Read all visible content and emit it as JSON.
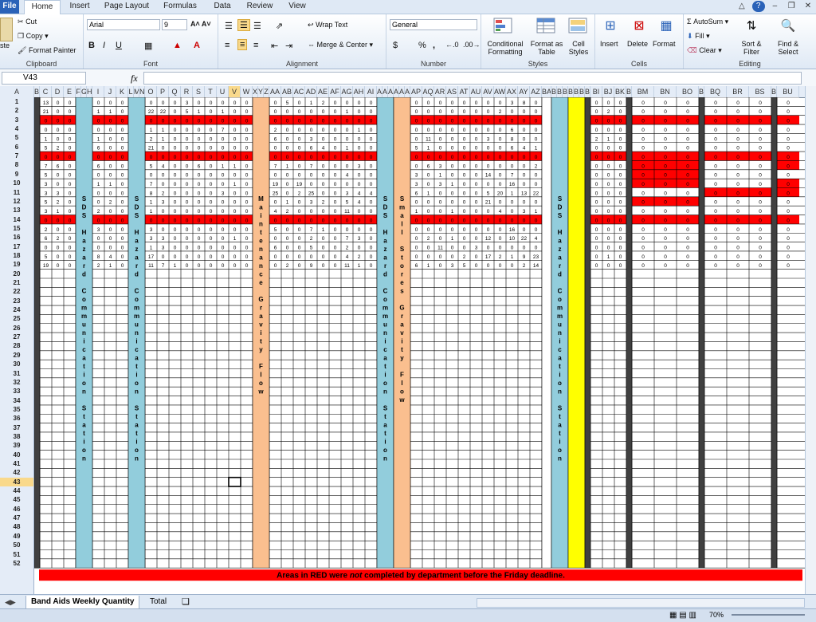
{
  "ribbon_tabs": [
    "File",
    "Home",
    "Insert",
    "Page Layout",
    "Formulas",
    "Data",
    "Review",
    "View"
  ],
  "clipboard": {
    "cut": "Cut",
    "copy": "Copy",
    "format_painter": "Format Painter",
    "paste_partial": "ste",
    "label": "Clipboard"
  },
  "font": {
    "name": "Arial",
    "size": "9",
    "label": "Font"
  },
  "alignment": {
    "wrap_text": "Wrap Text",
    "merge_center": "Merge & Center",
    "label": "Alignment"
  },
  "number": {
    "format": "General",
    "currency": "$",
    "percent": "%",
    "comma": ",",
    "label": "Number"
  },
  "styles": {
    "conditional": "Conditional Formatting",
    "format_table": "Format as Table",
    "cell_styles": "Cell Styles",
    "label": "Styles"
  },
  "cells_group": {
    "insert": "Insert",
    "delete": "Delete",
    "format": "Format",
    "label": "Cells"
  },
  "editing": {
    "autosum": "AutoSum",
    "fill": "Fill",
    "clear": "Clear",
    "sort_filter": "Sort & Filter",
    "find_select": "Find & Select",
    "label": "Editing"
  },
  "name_box": "V43",
  "fx_label": "fx",
  "formula_value": "",
  "selected_column": "V",
  "selected_row": 43,
  "column_letters": [
    "A",
    "B",
    "C",
    "D",
    "E",
    "F",
    "G",
    "H",
    "I",
    "J",
    "K",
    "L",
    "M",
    "N",
    "O",
    "P",
    "Q",
    "R",
    "S",
    "T",
    "U",
    "V",
    "W",
    "X",
    "Y",
    "Z",
    "AA",
    "AB",
    "AC",
    "AD",
    "AE",
    "AF",
    "AG",
    "AH",
    "AI",
    "AJ",
    "AK",
    "AL",
    "AM",
    "AN",
    "AO",
    "AP",
    "AQ",
    "AR",
    "AS",
    "AT",
    "AU",
    "AV",
    "AW",
    "AX",
    "AY",
    "AZ",
    "BA",
    "BB",
    "BC",
    "BD",
    "BE",
    "BF",
    "BG",
    "BH",
    "BI",
    "BJ",
    "BK",
    "BL",
    "BM",
    "BN",
    "BO",
    "BP",
    "BQ",
    "BR",
    "BS",
    "BT",
    "BU"
  ],
  "row_count": 52,
  "station_labels": {
    "sds_hazard": "SDS Hazard Communication Station",
    "maintenance": "Maintenance Gravity Flow",
    "small_stores": "Small Stores Gravity Flow"
  },
  "row_values": [
    {
      "block1": [
        "13",
        "0",
        "0"
      ],
      "block2": [
        "0",
        "0",
        "0"
      ],
      "block3": [
        "0",
        "0",
        "0",
        "3",
        "0",
        "0",
        "0",
        "0",
        "0"
      ],
      "block4": [
        "0",
        "5",
        "0",
        "1",
        "2",
        "0",
        "0",
        "0",
        "0"
      ],
      "block5": [
        "0",
        "0",
        "0",
        "0",
        "0",
        "0",
        "0",
        "0",
        "3",
        "8",
        "0"
      ],
      "block6": [
        "0",
        "0",
        "0"
      ],
      "block7": [
        "0",
        "0",
        "0"
      ],
      "block8": [
        "0",
        "0",
        "0"
      ],
      "block9": [
        "0"
      ]
    },
    {
      "block1": [
        "21",
        "0",
        "0"
      ],
      "block2": [
        "1",
        "1",
        "0"
      ],
      "block3": [
        "22",
        "22",
        "0",
        "5",
        "1",
        "0",
        "1",
        "0",
        "0"
      ],
      "block4": [
        "0",
        "0",
        "0",
        "0",
        "0",
        "0",
        "1",
        "0",
        "0"
      ],
      "block5": [
        "0",
        "0",
        "0",
        "0",
        "0",
        "0",
        "0",
        "2",
        "0",
        "0",
        "0"
      ],
      "block6": [
        "0",
        "2",
        "0"
      ],
      "block7": [
        "0",
        "0",
        "0"
      ],
      "block8": [
        "0",
        "0",
        "0"
      ],
      "block9": [
        "0"
      ]
    },
    {
      "block1": [
        "0",
        "0",
        "0"
      ],
      "block2": [
        "0",
        "0",
        "0"
      ],
      "block3": [
        "0",
        "0",
        "0",
        "0",
        "0",
        "0",
        "0",
        "0",
        "0"
      ],
      "block4": [
        "0",
        "0",
        "0",
        "0",
        "0",
        "0",
        "0",
        "0",
        "0"
      ],
      "block5": [
        "0",
        "0",
        "0",
        "0",
        "0",
        "0",
        "0",
        "0",
        "0",
        "0",
        "0"
      ],
      "block6": [
        "0",
        "0",
        "0"
      ],
      "block7": [
        "0",
        "0",
        "0"
      ],
      "block8": [
        "0",
        "0",
        "0"
      ],
      "block9": [
        "0"
      ]
    },
    {
      "block1": [
        "0",
        "0",
        "0"
      ],
      "block2": [
        "0",
        "0",
        "0"
      ],
      "block3": [
        "1",
        "1",
        "0",
        "0",
        "0",
        "0",
        "7",
        "0",
        "0"
      ],
      "block4": [
        "2",
        "0",
        "0",
        "0",
        "0",
        "0",
        "0",
        "1",
        "0"
      ],
      "block5": [
        "0",
        "0",
        "0",
        "0",
        "0",
        "0",
        "0",
        "0",
        "6",
        "0",
        "0"
      ],
      "block6": [
        "0",
        "0",
        "0"
      ],
      "block7": [
        "0",
        "0",
        "0"
      ],
      "block8": [
        "0",
        "0",
        "0"
      ],
      "block9": [
        "0"
      ]
    },
    {
      "block1": [
        "1",
        "0",
        "0"
      ],
      "block2": [
        "1",
        "0",
        "0"
      ],
      "block3": [
        "2",
        "1",
        "0",
        "0",
        "0",
        "0",
        "0",
        "0",
        "0"
      ],
      "block4": [
        "6",
        "0",
        "0",
        "3",
        "0",
        "0",
        "0",
        "0",
        "0"
      ],
      "block5": [
        "0",
        "11",
        "0",
        "0",
        "0",
        "0",
        "3",
        "0",
        "8",
        "0",
        "0"
      ],
      "block6": [
        "2",
        "1",
        "0"
      ],
      "block7": [
        "0",
        "0",
        "0"
      ],
      "block8": [
        "0",
        "0",
        "0"
      ],
      "block9": [
        "0"
      ]
    },
    {
      "block1": [
        "5",
        "2",
        "0"
      ],
      "block2": [
        "6",
        "0",
        "0"
      ],
      "block3": [
        "21",
        "0",
        "0",
        "0",
        "0",
        "0",
        "0",
        "0",
        "0"
      ],
      "block4": [
        "0",
        "0",
        "0",
        "6",
        "4",
        "0",
        "1",
        "0",
        "0"
      ],
      "block5": [
        "5",
        "1",
        "0",
        "0",
        "0",
        "0",
        "0",
        "0",
        "6",
        "4",
        "1"
      ],
      "block6": [
        "0",
        "0",
        "0"
      ],
      "block7": [
        "0",
        "0",
        "0"
      ],
      "block8": [
        "0",
        "0",
        "0"
      ],
      "block9": [
        "0"
      ]
    },
    {
      "block1": [
        "0",
        "0",
        "0"
      ],
      "block2": [
        "0",
        "0",
        "0"
      ],
      "block3": [
        "0",
        "0",
        "0",
        "0",
        "0",
        "0",
        "0",
        "0",
        "0"
      ],
      "block4": [
        "0",
        "0",
        "0",
        "0",
        "0",
        "0",
        "0",
        "0",
        "0"
      ],
      "block5": [
        "0",
        "0",
        "0",
        "0",
        "0",
        "0",
        "0",
        "0",
        "0",
        "0",
        "0"
      ],
      "block6": [
        "0",
        "0",
        "0"
      ],
      "block7": [
        "0",
        "0",
        "0"
      ],
      "block8": [
        "0",
        "0",
        "0"
      ],
      "block9": [
        "0"
      ]
    },
    {
      "block1": [
        "7",
        "6",
        "0"
      ],
      "block2": [
        "6",
        "0",
        "0"
      ],
      "block3": [
        "5",
        "4",
        "0",
        "0",
        "6",
        "0",
        "1",
        "1",
        "0"
      ],
      "block4": [
        "7",
        "1",
        "0",
        "7",
        "0",
        "0",
        "0",
        "3",
        "0"
      ],
      "block5": [
        "0",
        "6",
        "3",
        "0",
        "0",
        "0",
        "0",
        "0",
        "0",
        "0",
        "2"
      ],
      "block6": [
        "0",
        "0",
        "0"
      ],
      "block7": [
        "0",
        "0",
        "0"
      ],
      "block8": [
        "0",
        "0",
        "0"
      ],
      "block9": [
        "0"
      ]
    },
    {
      "block1": [
        "5",
        "0",
        "0"
      ],
      "block2": [
        "0",
        "0",
        "0"
      ],
      "block3": [
        "0",
        "0",
        "0",
        "0",
        "0",
        "0",
        "0",
        "0",
        "0"
      ],
      "block4": [
        "0",
        "0",
        "0",
        "0",
        "0",
        "0",
        "4",
        "0",
        "0"
      ],
      "block5": [
        "3",
        "0",
        "1",
        "0",
        "0",
        "0",
        "14",
        "0",
        "7",
        "0",
        "0"
      ],
      "block6": [
        "0",
        "0",
        "0"
      ],
      "block7": [
        "0",
        "0",
        "0"
      ],
      "block8": [
        "0",
        "0",
        "0"
      ],
      "block9": [
        "0"
      ]
    },
    {
      "block1": [
        "3",
        "0",
        "0"
      ],
      "block2": [
        "1",
        "1",
        "0"
      ],
      "block3": [
        "7",
        "0",
        "0",
        "0",
        "0",
        "0",
        "0",
        "1",
        "0"
      ],
      "block4": [
        "19",
        "0",
        "19",
        "0",
        "0",
        "0",
        "0",
        "0",
        "0"
      ],
      "block5": [
        "3",
        "0",
        "3",
        "1",
        "0",
        "0",
        "0",
        "0",
        "16",
        "0",
        "0"
      ],
      "block6": [
        "0",
        "0",
        "0"
      ],
      "block7": [
        "0",
        "0",
        "0"
      ],
      "block8": [
        "0",
        "0",
        "0"
      ],
      "block9": [
        "0"
      ]
    },
    {
      "block1": [
        "3",
        "3",
        "0"
      ],
      "block2": [
        "0",
        "0",
        "0"
      ],
      "block3": [
        "8",
        "2",
        "0",
        "0",
        "0",
        "0",
        "3",
        "0",
        "0"
      ],
      "block4": [
        "25",
        "0",
        "2",
        "25",
        "0",
        "0",
        "3",
        "4",
        "4"
      ],
      "block5": [
        "6",
        "1",
        "0",
        "0",
        "0",
        "0",
        "5",
        "20",
        "1",
        "13",
        "22"
      ],
      "block6": [
        "0",
        "0",
        "0"
      ],
      "block7": [
        "0",
        "0",
        "0"
      ],
      "block8": [
        "0",
        "0",
        "0"
      ],
      "block9": [
        "0"
      ]
    },
    {
      "block1": [
        "5",
        "2",
        "0"
      ],
      "block2": [
        "0",
        "2",
        "0"
      ],
      "block3": [
        "1",
        "3",
        "0",
        "0",
        "0",
        "0",
        "0",
        "0",
        "0"
      ],
      "block4": [
        "0",
        "1",
        "0",
        "3",
        "2",
        "0",
        "5",
        "4",
        "0"
      ],
      "block5": [
        "0",
        "0",
        "0",
        "0",
        "0",
        "0",
        "21",
        "0",
        "0",
        "0",
        "0"
      ],
      "block6": [
        "0",
        "0",
        "0"
      ],
      "block7": [
        "0",
        "0",
        "0"
      ],
      "block8": [
        "0",
        "0",
        "0"
      ],
      "block9": [
        "0"
      ]
    },
    {
      "block1": [
        "3",
        "1",
        "0"
      ],
      "block2": [
        "2",
        "0",
        "0"
      ],
      "block3": [
        "1",
        "0",
        "0",
        "0",
        "0",
        "0",
        "0",
        "0",
        "0"
      ],
      "block4": [
        "4",
        "2",
        "0",
        "0",
        "0",
        "0",
        "11",
        "0",
        "0"
      ],
      "block5": [
        "1",
        "0",
        "0",
        "1",
        "0",
        "0",
        "0",
        "4",
        "0",
        "3",
        "1"
      ],
      "block6": [
        "0",
        "0",
        "0"
      ],
      "block7": [
        "0",
        "0",
        "0"
      ],
      "block8": [
        "0",
        "0",
        "0"
      ],
      "block9": [
        "0"
      ]
    },
    {
      "block1": [
        "0",
        "0",
        "0"
      ],
      "block2": [
        "0",
        "0",
        "0"
      ],
      "block3": [
        "0",
        "0",
        "0",
        "0",
        "0",
        "0",
        "0",
        "0",
        "0"
      ],
      "block4": [
        "0",
        "0",
        "0",
        "0",
        "0",
        "0",
        "0",
        "0",
        "0"
      ],
      "block5": [
        "0",
        "0",
        "0",
        "0",
        "0",
        "0",
        "0",
        "0",
        "0",
        "0",
        "0"
      ],
      "block6": [
        "0",
        "0",
        "0"
      ],
      "block7": [
        "0",
        "0",
        "0"
      ],
      "block8": [
        "0",
        "0",
        "0"
      ],
      "block9": [
        "0"
      ]
    },
    {
      "block1": [
        "2",
        "0",
        "0"
      ],
      "block2": [
        "3",
        "0",
        "0"
      ],
      "block3": [
        "3",
        "0",
        "0",
        "0",
        "0",
        "0",
        "0",
        "0",
        "0"
      ],
      "block4": [
        "5",
        "0",
        "0",
        "7",
        "1",
        "0",
        "0",
        "0",
        "0"
      ],
      "block5": [
        "0",
        "0",
        "0",
        "0",
        "0",
        "0",
        "0",
        "0",
        "16",
        "0",
        "0"
      ],
      "block6": [
        "0",
        "0",
        "0"
      ],
      "block7": [
        "0",
        "0",
        "0"
      ],
      "block8": [
        "0",
        "0",
        "0"
      ],
      "block9": [
        "0"
      ]
    },
    {
      "block1": [
        "6",
        "2",
        "0"
      ],
      "block2": [
        "0",
        "0",
        "0"
      ],
      "block3": [
        "3",
        "3",
        "0",
        "0",
        "0",
        "0",
        "0",
        "1",
        "0"
      ],
      "block4": [
        "0",
        "0",
        "0",
        "2",
        "0",
        "0",
        "7",
        "3",
        "0"
      ],
      "block5": [
        "0",
        "2",
        "0",
        "1",
        "0",
        "0",
        "12",
        "0",
        "10",
        "22",
        "4"
      ],
      "block6": [
        "0",
        "0",
        "0"
      ],
      "block7": [
        "0",
        "0",
        "0"
      ],
      "block8": [
        "0",
        "0",
        "0"
      ],
      "block9": [
        "0"
      ]
    },
    {
      "block1": [
        "0",
        "0",
        "0"
      ],
      "block2": [
        "0",
        "0",
        "0"
      ],
      "block3": [
        "1",
        "3",
        "0",
        "0",
        "0",
        "0",
        "0",
        "0",
        "0"
      ],
      "block4": [
        "6",
        "0",
        "0",
        "5",
        "0",
        "0",
        "2",
        "0",
        "0"
      ],
      "block5": [
        "0",
        "0",
        "11",
        "0",
        "0",
        "3",
        "0",
        "0",
        "0",
        "0",
        "0"
      ],
      "block6": [
        "0",
        "0",
        "0"
      ],
      "block7": [
        "0",
        "0",
        "0"
      ],
      "block8": [
        "0",
        "0",
        "0"
      ],
      "block9": [
        "0"
      ]
    },
    {
      "block1": [
        "5",
        "0",
        "0"
      ],
      "block2": [
        "8",
        "4",
        "0"
      ],
      "block3": [
        "17",
        "0",
        "0",
        "0",
        "0",
        "0",
        "0",
        "0",
        "0"
      ],
      "block4": [
        "0",
        "0",
        "0",
        "0",
        "0",
        "0",
        "4",
        "2",
        "0"
      ],
      "block5": [
        "0",
        "0",
        "0",
        "0",
        "2",
        "0",
        "17",
        "2",
        "1",
        "9",
        "23"
      ],
      "block6": [
        "0",
        "1",
        "0"
      ],
      "block7": [
        "0",
        "0",
        "0"
      ],
      "block8": [
        "0",
        "0",
        "0"
      ],
      "block9": [
        "0"
      ]
    },
    {
      "block1": [
        "19",
        "0",
        "0"
      ],
      "block2": [
        "2",
        "1",
        "0"
      ],
      "block3": [
        "11",
        "7",
        "1",
        "0",
        "0",
        "0",
        "0",
        "0",
        "0"
      ],
      "block4": [
        "0",
        "2",
        "0",
        "9",
        "0",
        "0",
        "11",
        "1",
        "0"
      ],
      "block5": [
        "6",
        "1",
        "0",
        "3",
        "5",
        "0",
        "0",
        "0",
        "0",
        "2",
        "14"
      ],
      "block6": [
        "0",
        "0",
        "0"
      ],
      "block7": [
        "0",
        "0",
        "0"
      ],
      "block8": [
        "0",
        "0",
        "0"
      ],
      "block9": [
        "0"
      ]
    }
  ],
  "red_rows": [
    3,
    7,
    14
  ],
  "extra_red": [
    {
      "row": 8,
      "block": "block7"
    },
    {
      "row": 9,
      "block": "block7"
    },
    {
      "row": 10,
      "block": "block7"
    },
    {
      "row": 8,
      "block": "block9"
    },
    {
      "row": 10,
      "block": "block9"
    },
    {
      "row": 11,
      "block": "block9"
    },
    {
      "row": 11,
      "block": "block8"
    },
    {
      "row": 12,
      "block": "block7"
    }
  ],
  "footer_notice": {
    "before": "Areas in RED were ",
    "emphasis": "not",
    "after": " completed by department before the Friday deadline."
  },
  "sheet_tabs": [
    {
      "label": "Band Aids Weekly Quantity",
      "active": true
    },
    {
      "label": "Total",
      "active": false
    }
  ],
  "zoom": "70%",
  "colors": {
    "red": "#ff0000",
    "blue_station": "#92cddc",
    "orange_station": "#fabf8f",
    "yellow": "#ffff00",
    "selected_header": "#f9d98b"
  }
}
